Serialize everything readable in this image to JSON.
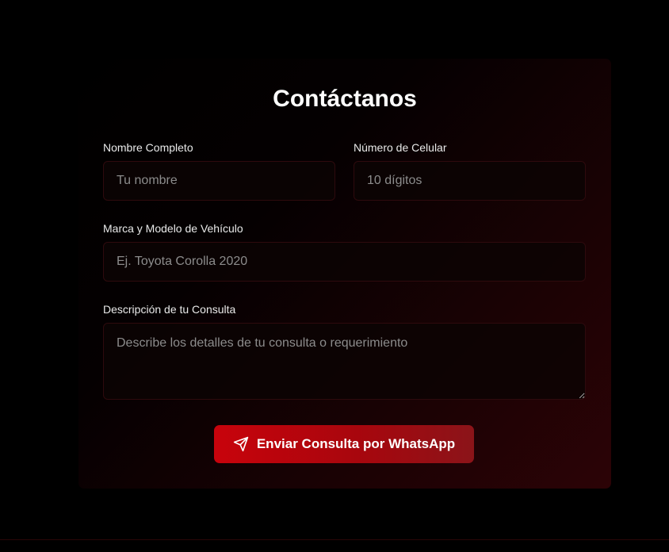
{
  "form": {
    "title": "Contáctanos",
    "name": {
      "label": "Nombre Completo",
      "placeholder": "Tu nombre"
    },
    "phone": {
      "label": "Número de Celular",
      "placeholder": "10 dígitos"
    },
    "vehicle": {
      "label": "Marca y Modelo de Vehículo",
      "placeholder": "Ej. Toyota Corolla 2020"
    },
    "description": {
      "label": "Descripción de tu Consulta",
      "placeholder": "Describe los detalles de tu consulta o requerimiento"
    },
    "submit": {
      "label": "Enviar Consulta por WhatsApp",
      "icon": "send-icon"
    }
  },
  "colors": {
    "background": "#000000",
    "accent": "#c8030c",
    "card_tint": "#2c0306"
  }
}
